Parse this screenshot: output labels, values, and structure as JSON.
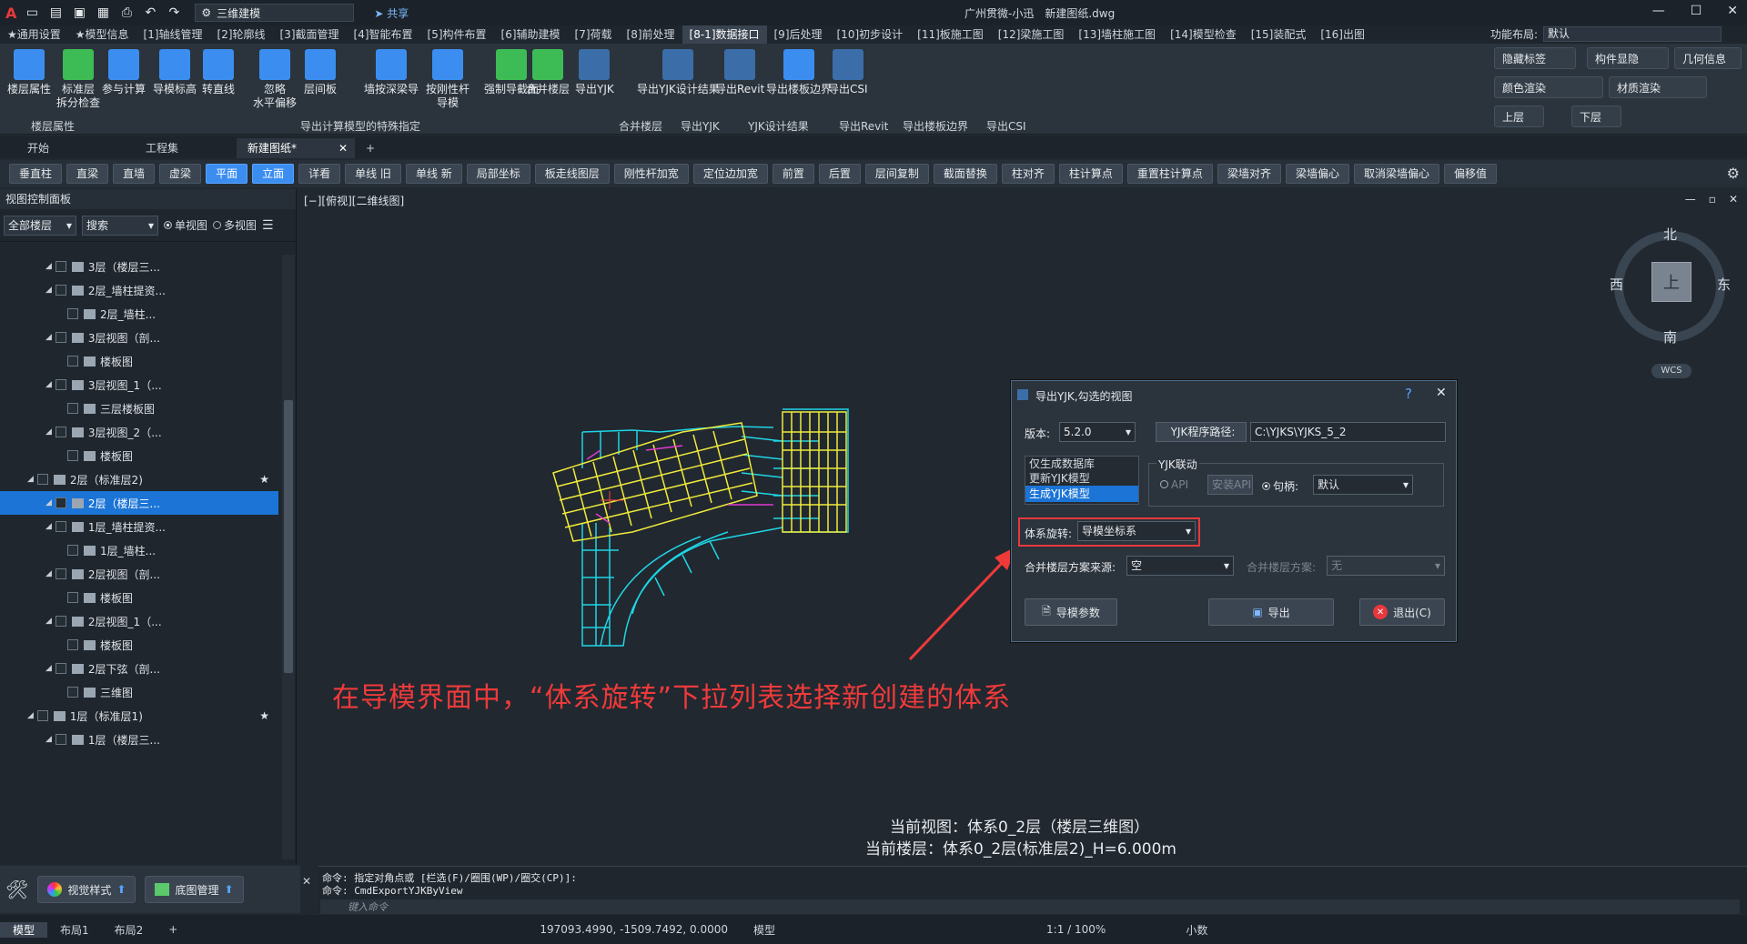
{
  "app": {
    "title": "广州贯微-小迅　新建图纸.dwg",
    "workspace": "三维建模",
    "share": "共享"
  },
  "menu_tabs": [
    "★通用设置",
    "★模型信息",
    "[1]轴线管理",
    "[2]轮廓线",
    "[3]截面管理",
    "[4]智能布置",
    "[5]构件布置",
    "[6]辅助建模",
    "[7]荷载",
    "[8]前处理",
    "[8-1]数据接口",
    "[9]后处理",
    "[10]初步设计",
    "[11]板施工图",
    "[12]梁施工图",
    "[13]墙柱施工图",
    "[14]模型检查",
    "[15]装配式",
    "[16]出图"
  ],
  "function_layout": {
    "label": "功能布局:",
    "value": "默认"
  },
  "ribbon": {
    "buttons": [
      "楼层属性",
      "标准层\n拆分检查",
      "参与计算",
      "导模标高",
      "转直线",
      "忽略\n水平偏移",
      "层间板",
      "墙按深梁导",
      "按刚性杆\n导模",
      "强制导截面",
      "合并楼层",
      "导出YJK",
      "导出YJK设计结果",
      "导出Revit",
      "导出楼板边界",
      "导出CSI"
    ],
    "groups": [
      "楼层属性",
      "导出计算模型的特殊指定",
      "合并楼层",
      "导出YJK",
      "YJK设计结果",
      "导出Revit",
      "导出楼板边界",
      "导出CSI"
    ],
    "right": [
      "隐藏标签",
      "构件显隐",
      "几何信息",
      "颜色渲染",
      "材质渲染",
      "上层",
      "下层"
    ]
  },
  "doc_tabs": [
    "开始",
    "工程集",
    "新建图纸*"
  ],
  "toolbar": [
    "垂直柱",
    "直梁",
    "直墙",
    "虚梁",
    "平面",
    "立面",
    "详看",
    "单线 旧",
    "单线 新",
    "局部坐标",
    "板走线图层",
    "刚性杆加宽",
    "定位边加宽",
    "前置",
    "后置",
    "层间复制",
    "截面替换",
    "柱对齐",
    "柱计算点",
    "重置柱计算点",
    "梁墙对齐",
    "梁墙偏心",
    "取消梁墙偏心",
    "偏移值"
  ],
  "left_panel": {
    "title": "视图控制面板",
    "floor_filter": "全部楼层",
    "search": "搜索",
    "single_view": "单视图",
    "multi_view": "多视图",
    "tree": [
      "3层（楼层三...",
      "2层_墙柱提资...",
      "2层_墙柱...",
      "3层视图（剖...",
      "楼板图",
      "3层视图_1（...",
      "三层楼板图",
      "3层视图_2（...",
      "楼板图",
      "2层（标准层2)",
      "2层（楼层三...",
      "1层_墙柱提资...",
      "1层_墙柱...",
      "2层视图（剖...",
      "楼板图",
      "2层视图_1（...",
      "楼板图",
      "2层下弦（剖...",
      "三维图",
      "1层（标准层1)",
      "1层（楼层三..."
    ],
    "bottom": [
      "视觉样式",
      "底图管理"
    ]
  },
  "canvas": {
    "view_label": "[−][俯视][二维线图]",
    "compass": {
      "n": "北",
      "s": "南",
      "e": "东",
      "w": "西",
      "center": "上",
      "wcs": "WCS"
    },
    "annotation": "在导模界面中，“体系旋转”下拉列表选择新创建的体系",
    "current_view": "当前视图：体系0_2层（楼层三维图）",
    "current_floor": "当前楼层：体系0_2层(标准层2)_H=6.000m"
  },
  "dialog": {
    "title": "导出YJK,勾选的视图",
    "version_label": "版本:",
    "version": "5.2.0",
    "path_label": "YJK程序路径:",
    "path": "C:\\YJKS\\YJKS_5_2",
    "list": [
      "仅生成数据库",
      "更新YJK模型",
      "生成YJK模型"
    ],
    "yjk_link": "YJK联动",
    "api": "API",
    "install_api": "安装API",
    "handle_label": "句柄:",
    "handle": "默认",
    "rotation_label": "体系旋转:",
    "rotation": "导模坐标系",
    "merge_src_label": "合并楼层方案来源:",
    "merge_src": "空",
    "merge_label": "合并楼层方案:",
    "merge": "无",
    "btn_params": "导模参数",
    "btn_export": "导出",
    "btn_exit": "退出(C)"
  },
  "command": {
    "line1": "命令: 指定对角点或 [栏选(F)/圈围(WP)/圈交(CP)]:",
    "line2": "命令: CmdExportYJKByView",
    "placeholder": "键入命令"
  },
  "status": {
    "tabs": [
      "模型",
      "布局1",
      "布局2"
    ],
    "coords": "197093.4990, -1509.7492, 0.0000",
    "model": "模型",
    "scale": "1:1 / 100%",
    "units": "小数"
  },
  "colors": {
    "accent": "#3b8ef0",
    "highlight": "#f03a3a",
    "cyan": "#1fd6e6",
    "yellow": "#f0ea3a",
    "magenta": "#e03ad0"
  }
}
